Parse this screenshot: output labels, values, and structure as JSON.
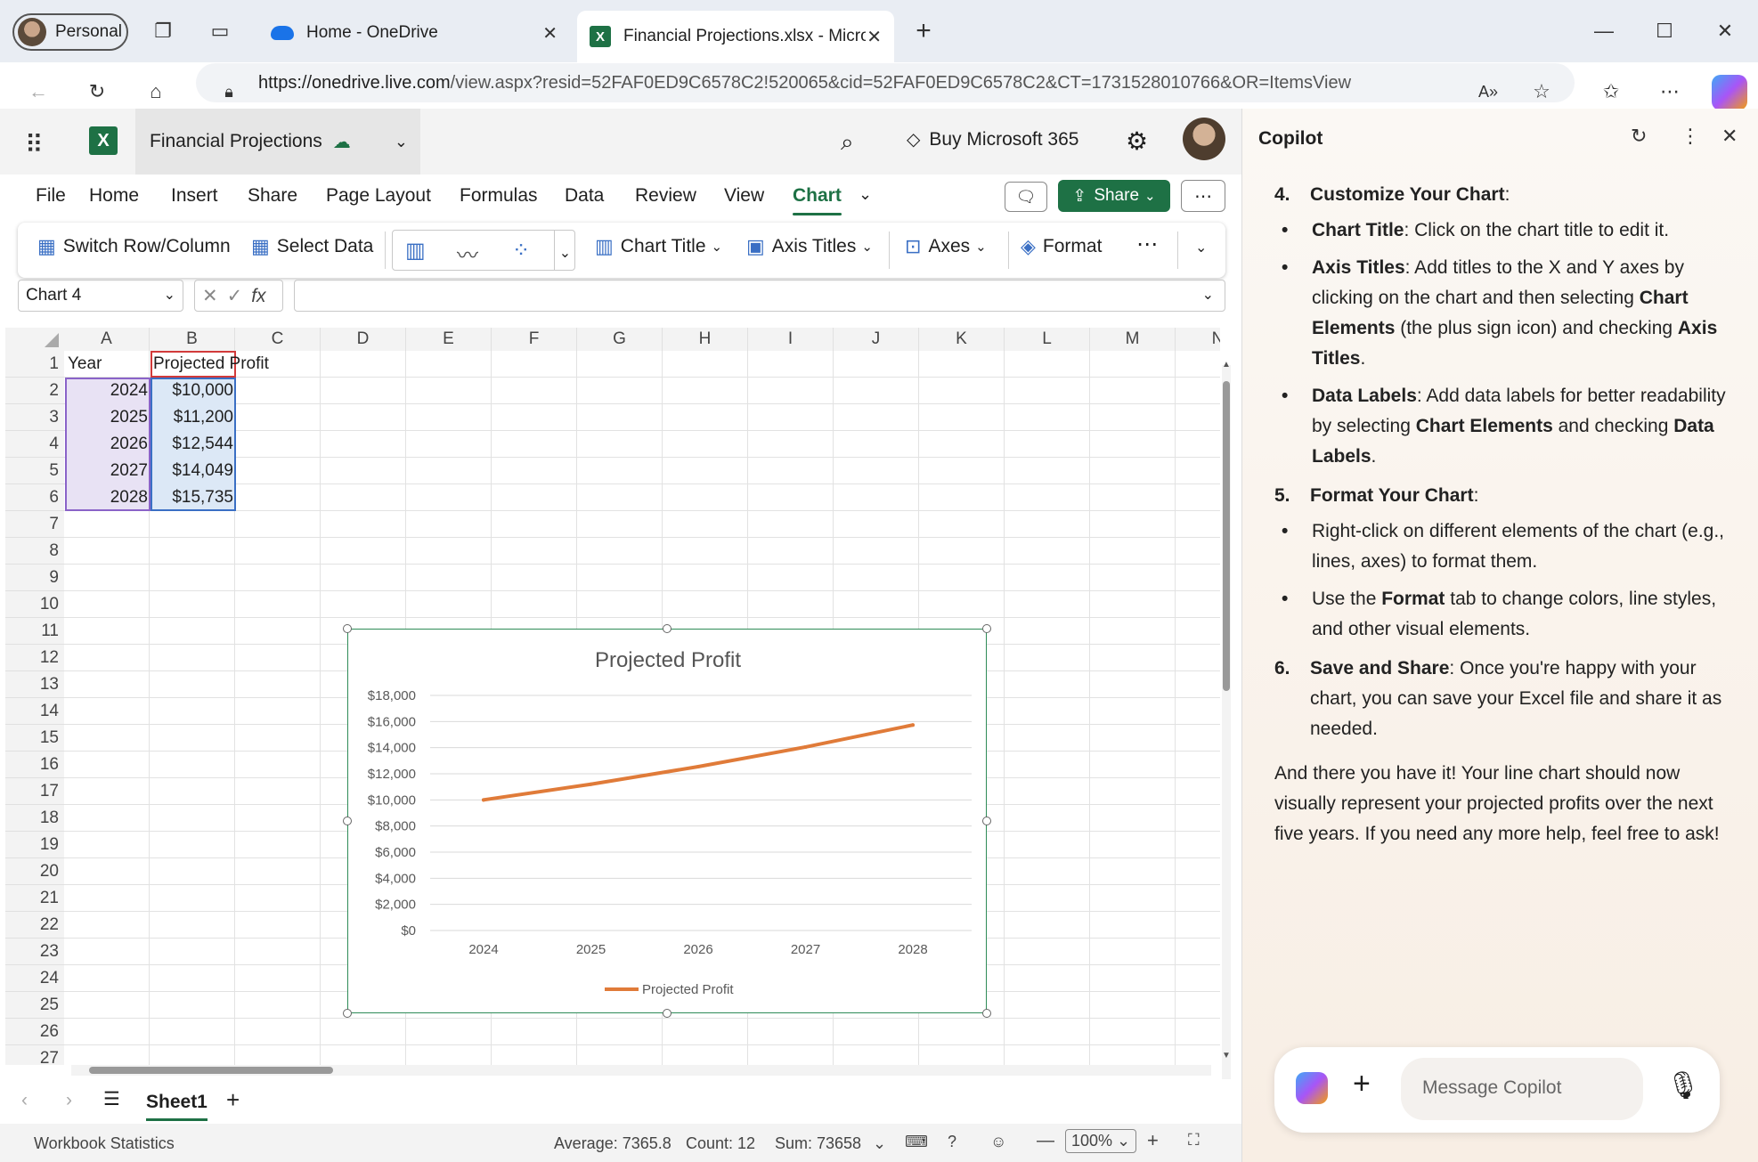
{
  "browser": {
    "profile": "Personal",
    "tabs": [
      {
        "label": "Home - OneDrive"
      },
      {
        "label": "Financial Projections.xlsx - Micros"
      }
    ],
    "url_host": "https://onedrive.live.com",
    "url_path": "/view.aspx?resid=52FAF0ED9C6578C2!520065&cid=52FAF0ED9C6578C2&CT=1731528010766&OR=ItemsView"
  },
  "excel": {
    "doc_name": "Financial Projections",
    "buy_label": "Buy Microsoft 365",
    "menu": [
      "File",
      "Home",
      "Insert",
      "Share",
      "Page Layout",
      "Formulas",
      "Data",
      "Review",
      "View",
      "Chart"
    ],
    "share_label": "Share",
    "ribbon": {
      "switch": "Switch Row/Column",
      "select_data": "Select Data",
      "chart_title": "Chart Title",
      "axis_titles": "Axis Titles",
      "axes": "Axes",
      "format": "Format"
    },
    "name_box": "Chart 4",
    "columns": [
      "A",
      "B",
      "C",
      "D",
      "E",
      "F",
      "G",
      "H",
      "I",
      "J",
      "K",
      "L",
      "M",
      "N"
    ],
    "rows": [
      "1",
      "2",
      "3",
      "4",
      "5",
      "6",
      "7",
      "8",
      "9",
      "10",
      "11",
      "12",
      "13",
      "14",
      "15",
      "16",
      "17",
      "18",
      "19",
      "20",
      "21",
      "22",
      "23",
      "24",
      "25",
      "26",
      "27"
    ],
    "cells": {
      "a1": "Year",
      "b1": "Projected Profit",
      "a2": "2024",
      "b2": "$10,000",
      "a3": "2025",
      "b3": "$11,200",
      "a4": "2026",
      "b4": "$12,544",
      "a5": "2027",
      "b5": "$14,049",
      "a6": "2028",
      "b6": "$15,735"
    },
    "sheet_tab": "Sheet1",
    "status": {
      "left": "Workbook Statistics",
      "average": "Average: 7365.8",
      "count": "Count: 12",
      "sum": "Sum: 73658",
      "zoom": "100%"
    }
  },
  "chart_data": {
    "type": "line",
    "title": "Projected Profit",
    "categories": [
      "2024",
      "2025",
      "2026",
      "2027",
      "2028"
    ],
    "series": [
      {
        "name": "Projected Profit",
        "values": [
          10000,
          11200,
          12544,
          14049,
          15735
        ]
      }
    ],
    "ylim": [
      0,
      18000
    ],
    "yticks": [
      "$0",
      "$2,000",
      "$4,000",
      "$6,000",
      "$8,000",
      "$10,000",
      "$12,000",
      "$14,000",
      "$16,000",
      "$18,000"
    ],
    "grid": true,
    "legend": "bottom",
    "line_color": "#e07b39"
  },
  "copilot": {
    "title": "Copilot",
    "step4": {
      "num": "4.",
      "title": "Customize Your Chart",
      "tail": ":"
    },
    "b41": {
      "lead": "Chart Title",
      "text": ": Click on the chart title to edit it."
    },
    "b42": {
      "lead": "Axis Titles",
      "t1": ": Add titles to the X and Y axes by clicking on the chart and then selecting ",
      "b1": "Chart Elements",
      "t2": " (the plus sign icon) and checking ",
      "b2": "Axis Titles",
      "t3": "."
    },
    "b43": {
      "lead": "Data Labels",
      "t1": ": Add data labels for better readability by selecting ",
      "b1": "Chart Elements",
      "t2": " and checking ",
      "b2": "Data Labels",
      "t3": "."
    },
    "step5": {
      "num": "5.",
      "title": "Format Your Chart",
      "tail": ":"
    },
    "b51": {
      "text": "Right-click on different elements of the chart (e.g., lines, axes) to format them."
    },
    "b52": {
      "t1": "Use the ",
      "b1": "Format",
      "t2": " tab to change colors, line styles, and other visual elements."
    },
    "step6": {
      "num": "6.",
      "title": "Save and Share",
      "tail": ": Once you're happy with your chart, you can save your Excel file and share it as needed."
    },
    "closing": "And there you have it! Your line chart should now visually represent your projected profits over the next five years. If you need any more help, feel free to ask!",
    "placeholder": "Message Copilot"
  }
}
